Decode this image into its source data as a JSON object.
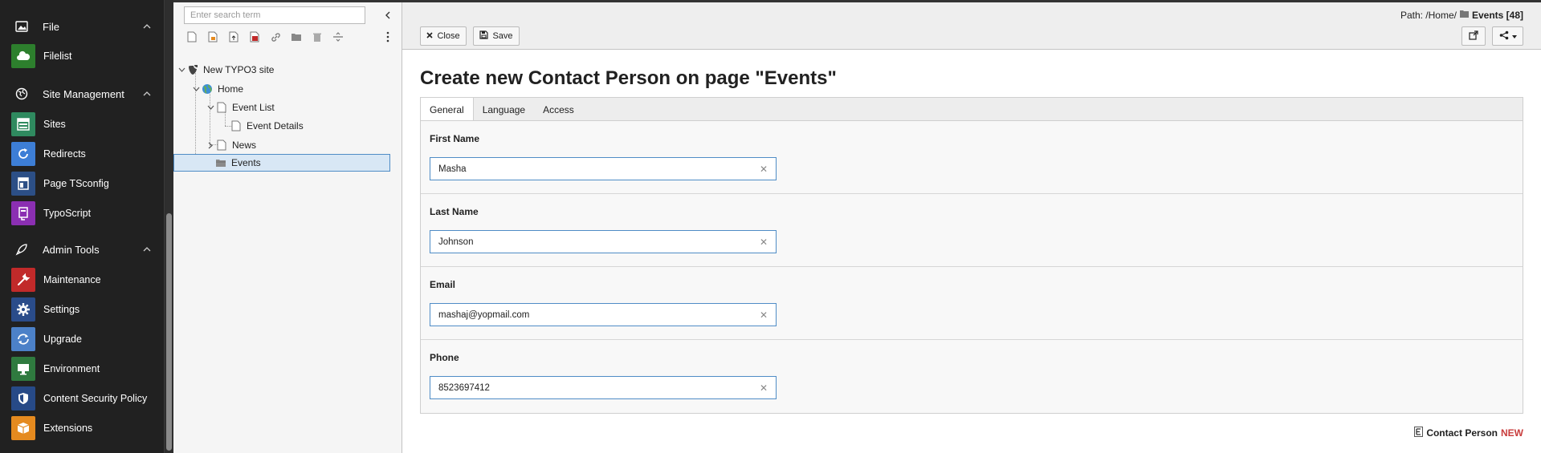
{
  "module_menu": {
    "groups": [
      {
        "label": "File",
        "icon": "image-icon",
        "items": [
          {
            "label": "Filelist",
            "icon": "cloud-folder-icon",
            "color": "#2d7f2d"
          }
        ]
      },
      {
        "label": "Site Management",
        "icon": "globe-icon",
        "items": [
          {
            "label": "Sites",
            "icon": "sites-icon",
            "color": "#2f8a5f"
          },
          {
            "label": "Redirects",
            "icon": "redirect-icon",
            "color": "#3d7ed6"
          },
          {
            "label": "Page TSconfig",
            "icon": "page-tsconfig-icon",
            "color": "#2c4f86"
          },
          {
            "label": "TypoScript",
            "icon": "typoscript-icon",
            "color": "#8b2fb2"
          }
        ]
      },
      {
        "label": "Admin Tools",
        "icon": "rocket-icon",
        "items": [
          {
            "label": "Maintenance",
            "icon": "wrench-icon",
            "color": "#c12a2a"
          },
          {
            "label": "Settings",
            "icon": "gear-icon",
            "color": "#2a4c8a"
          },
          {
            "label": "Upgrade",
            "icon": "refresh-icon",
            "color": "#4c81c8"
          },
          {
            "label": "Environment",
            "icon": "monitor-icon",
            "color": "#2f7a3f"
          },
          {
            "label": "Content Security Policy",
            "icon": "shield-icon",
            "color": "#274a87"
          },
          {
            "label": "Extensions",
            "icon": "box-icon",
            "color": "#e58a1f"
          }
        ]
      }
    ]
  },
  "page_tree": {
    "search_placeholder": "Enter search term",
    "nodes": [
      {
        "label": "New TYPO3 site"
      },
      {
        "label": "Home"
      },
      {
        "label": "Event List"
      },
      {
        "label": "Event Details"
      },
      {
        "label": "News"
      },
      {
        "label": "Events"
      }
    ]
  },
  "doc_header": {
    "path_prefix": "Path: /Home/",
    "path_title": "Events [48]",
    "close_label": "Close",
    "save_label": "Save"
  },
  "form": {
    "title": "Create new Contact Person on page \"Events\"",
    "tabs": [
      "General",
      "Language",
      "Access"
    ],
    "fields": [
      {
        "label": "First Name",
        "value": "Masha"
      },
      {
        "label": "Last Name",
        "value": "Johnson"
      },
      {
        "label": "Email",
        "value": "mashaj@yopmail.com"
      },
      {
        "label": "Phone",
        "value": "8523697412"
      }
    ],
    "record_type": "Contact Person",
    "record_state": "NEW"
  },
  "colors": {
    "sidebar_bg": "#212121",
    "tree_bg": "#f5f5f5",
    "selection": "#d8e7f5",
    "input_border": "#4f8cc6",
    "new_badge": "#c83c3c"
  }
}
